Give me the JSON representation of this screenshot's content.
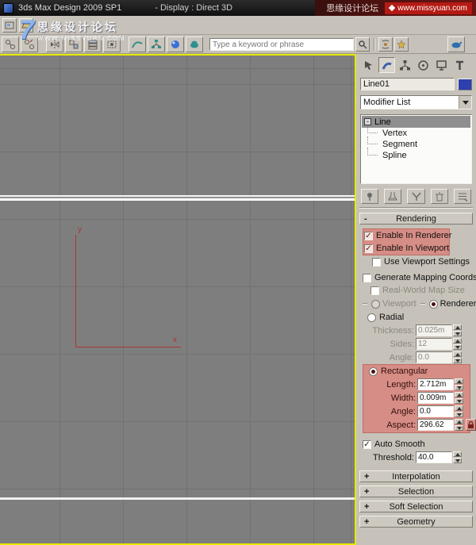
{
  "title_bar": {
    "app_title": "3ds Max Design 2009 SP1",
    "display_mode": "- Display : Direct 3D",
    "site_name": "思缘设计论坛",
    "site_url": "www.missyuan.com"
  },
  "watermark": {
    "logo_glyph": "7",
    "site_name": "思缘设计论坛",
    "site_url": "WWW.MISSYUAN.COM"
  },
  "toolbar": {
    "search_placeholder": "Type a keyword or phrase"
  },
  "viewport": {
    "y_axis_label": "y",
    "x_axis_label": "x",
    "colors": {
      "background": "#7e7e7e",
      "grid_line": "#717171",
      "spline": "#ffffff",
      "axis": "#b03434",
      "active_border": "#e9e900"
    }
  },
  "glyphs": {
    "check": "✓",
    "minus": "-",
    "plus": "+"
  },
  "command_panel": {
    "tabs": [
      "create",
      "modify",
      "hierarchy",
      "motion",
      "display",
      "utilities"
    ],
    "active_tab": "modify",
    "object_name": "Line01",
    "object_color": "#2e3fae",
    "modifier_list_label": "Modifier List",
    "modifier_stack": {
      "root": "Line",
      "children": [
        "Vertex",
        "Segment",
        "Spline"
      ]
    },
    "rendering": {
      "title": "Rendering",
      "enable_in_renderer": "Enable In Renderer",
      "enable_in_viewport": "Enable In Viewport",
      "use_viewport_settings": "Use Viewport Settings",
      "generate_mapping": "Generate Mapping Coords.",
      "real_world_map": "Real-World Map Size",
      "viewport_radio": "Viewport",
      "renderer_radio": "Renderer",
      "radial_radio": "Radial",
      "thickness_label": "Thickness:",
      "thickness_value": "0.025m",
      "sides_label": "Sides:",
      "sides_value": "12",
      "angle_radial_label": "Angle:",
      "angle_radial_value": "0.0",
      "rectangular_radio": "Rectangular",
      "length_label": "Length:",
      "length_value": "2.712m",
      "width_label": "Width:",
      "width_value": "0.009m",
      "angle_rect_label": "Angle:",
      "angle_rect_value": "0.0",
      "aspect_label": "Aspect:",
      "aspect_value": "296.62",
      "auto_smooth": "Auto Smooth",
      "threshold_label": "Threshold:",
      "threshold_value": "40.0",
      "highlight_color": "#d68d85"
    },
    "rollouts_closed": [
      "Interpolation",
      "Selection",
      "Soft Selection",
      "Geometry"
    ]
  }
}
